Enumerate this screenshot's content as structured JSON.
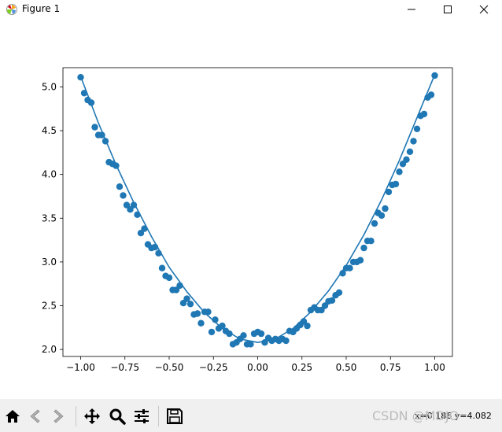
{
  "window": {
    "title": "Figure 1",
    "icons": {
      "app": "matplotlib-logo-icon",
      "minimize": "minimize-icon",
      "maximize": "maximize-icon",
      "close": "close-icon"
    }
  },
  "toolbar": {
    "buttons": [
      {
        "name": "home-button",
        "icon": "home-icon"
      },
      {
        "name": "back-button",
        "icon": "back-arrow-icon"
      },
      {
        "name": "forward-button",
        "icon": "forward-arrow-icon"
      },
      {
        "name": "pan-button",
        "icon": "pan-arrows-icon"
      },
      {
        "name": "zoom-button",
        "icon": "magnifier-icon"
      },
      {
        "name": "subplots-button",
        "icon": "sliders-icon"
      },
      {
        "name": "save-button",
        "icon": "floppy-disk-icon"
      }
    ],
    "coords": "x=0.186  y=4.082",
    "watermark": "CSDN @MDJO"
  },
  "chart_data": {
    "type": "scatter",
    "title": "",
    "xlabel": "",
    "ylabel": "",
    "xlim": [
      -1.1,
      1.1
    ],
    "ylim": [
      1.92,
      5.22
    ],
    "grid": false,
    "color": "#1f77b4",
    "xticks": [
      "−1.00",
      "−0.75",
      "−0.50",
      "−0.25",
      "0.00",
      "0.25",
      "0.50",
      "0.75",
      "1.00"
    ],
    "xtick_values": [
      -1.0,
      -0.75,
      -0.5,
      -0.25,
      0.0,
      0.25,
      0.5,
      0.75,
      1.0
    ],
    "yticks": [
      "2.0",
      "2.5",
      "3.0",
      "3.5",
      "4.0",
      "4.5",
      "5.0"
    ],
    "ytick_values": [
      2.0,
      2.5,
      3.0,
      3.5,
      4.0,
      4.5,
      5.0
    ],
    "series": [
      {
        "type": "line",
        "x": [
          -1.0,
          -0.9,
          -0.8,
          -0.7,
          -0.6,
          -0.5,
          -0.4,
          -0.3,
          -0.2,
          -0.1,
          0.0,
          0.1,
          0.2,
          0.3,
          0.4,
          0.5,
          0.6,
          0.7,
          0.8,
          0.9,
          1.0
        ],
        "y": [
          5.12,
          4.59,
          4.11,
          3.68,
          3.29,
          2.94,
          2.66,
          2.42,
          2.24,
          2.12,
          2.08,
          2.12,
          2.24,
          2.43,
          2.67,
          2.96,
          3.31,
          3.71,
          4.16,
          4.65,
          5.14
        ]
      },
      {
        "type": "scatter",
        "x": [
          -1.0,
          -0.98,
          -0.96,
          -0.94,
          -0.92,
          -0.9,
          -0.88,
          -0.86,
          -0.84,
          -0.82,
          -0.8,
          -0.78,
          -0.76,
          -0.74,
          -0.72,
          -0.7,
          -0.68,
          -0.66,
          -0.64,
          -0.62,
          -0.6,
          -0.58,
          -0.56,
          -0.54,
          -0.52,
          -0.5,
          -0.48,
          -0.46,
          -0.44,
          -0.42,
          -0.4,
          -0.38,
          -0.36,
          -0.34,
          -0.32,
          -0.3,
          -0.28,
          -0.26,
          -0.24,
          -0.22,
          -0.2,
          -0.18,
          -0.16,
          -0.14,
          -0.12,
          -0.1,
          -0.08,
          -0.06,
          -0.04,
          -0.02,
          0.0,
          0.02,
          0.04,
          0.06,
          0.08,
          0.1,
          0.12,
          0.14,
          0.16,
          0.18,
          0.2,
          0.22,
          0.24,
          0.26,
          0.28,
          0.3,
          0.32,
          0.34,
          0.36,
          0.38,
          0.4,
          0.42,
          0.44,
          0.46,
          0.48,
          0.5,
          0.52,
          0.54,
          0.56,
          0.58,
          0.6,
          0.62,
          0.64,
          0.66,
          0.68,
          0.7,
          0.72,
          0.74,
          0.76,
          0.78,
          0.8,
          0.82,
          0.84,
          0.86,
          0.88,
          0.9,
          0.92,
          0.94,
          0.96,
          0.98,
          1.0
        ],
        "y": [
          5.11,
          4.93,
          4.85,
          4.82,
          4.54,
          4.45,
          4.45,
          4.38,
          4.14,
          4.12,
          4.1,
          3.86,
          3.76,
          3.65,
          3.6,
          3.65,
          3.54,
          3.33,
          3.38,
          3.2,
          3.16,
          3.17,
          3.1,
          2.93,
          2.84,
          2.82,
          2.68,
          2.68,
          2.73,
          2.53,
          2.58,
          2.52,
          2.4,
          2.41,
          2.3,
          2.43,
          2.43,
          2.2,
          2.34,
          2.24,
          2.27,
          2.21,
          2.18,
          2.06,
          2.08,
          2.12,
          2.16,
          2.06,
          2.06,
          2.18,
          2.2,
          2.18,
          2.08,
          2.13,
          2.1,
          2.12,
          2.1,
          2.12,
          2.1,
          2.21,
          2.2,
          2.24,
          2.28,
          2.32,
          2.27,
          2.45,
          2.48,
          2.45,
          2.45,
          2.5,
          2.55,
          2.56,
          2.62,
          2.65,
          2.87,
          2.93,
          2.93,
          3.0,
          3.0,
          3.02,
          3.16,
          3.24,
          3.24,
          3.44,
          3.56,
          3.53,
          3.61,
          3.8,
          3.88,
          3.89,
          4.03,
          4.12,
          4.17,
          4.26,
          4.38,
          4.52,
          4.67,
          4.69,
          4.88,
          4.91,
          5.13
        ]
      }
    ]
  }
}
